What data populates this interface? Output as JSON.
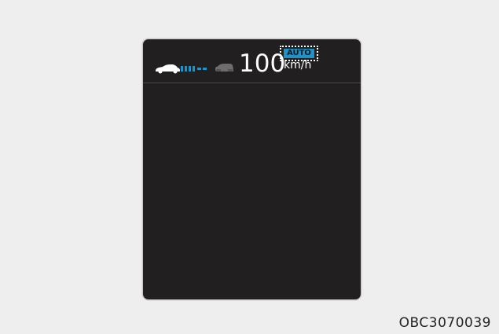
{
  "cluster_display": {
    "speed": {
      "value": "100",
      "unit": "km/h"
    },
    "mode_badge": "AUTO",
    "icons": {
      "own_vehicle": "car-icon",
      "following_distance": "distance-bars-icon",
      "lead_vehicle": "lead-car-icon"
    },
    "colors": {
      "panel_background": "#221f20",
      "accent_blue": "#1f93c8",
      "text": "#ffffff"
    }
  },
  "figure_code": "OBC3070039"
}
